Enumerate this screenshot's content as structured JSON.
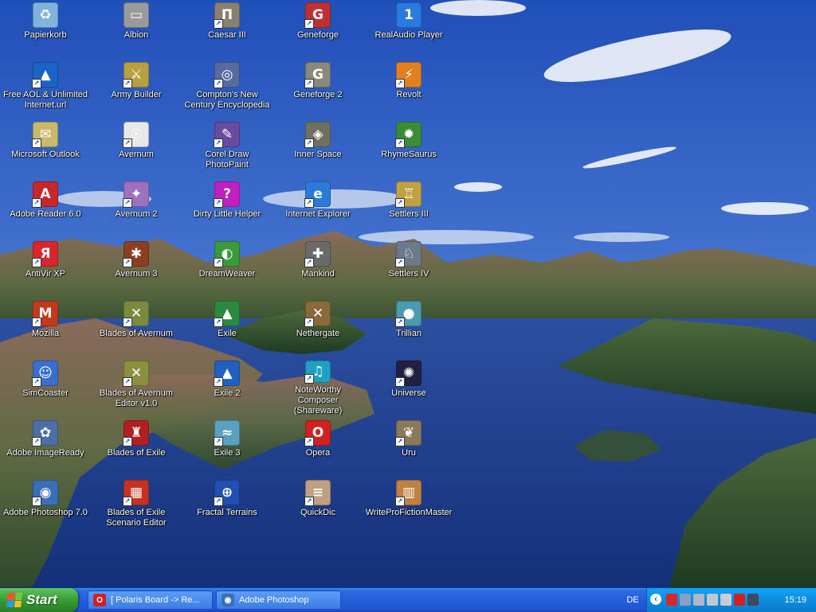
{
  "desktop": {
    "icons": [
      {
        "label": "Papierkorb",
        "icon": "recycle-bin-icon",
        "color": "#7fb3de",
        "glyph": "♻",
        "shortcut": false
      },
      {
        "label": "Free AOL & Unlimited Internet.url",
        "icon": "aol-icon",
        "color": "#1a63c7",
        "glyph": "▲",
        "shortcut": true
      },
      {
        "label": "Microsoft Outlook",
        "icon": "outlook-icon",
        "color": "#c9b96a",
        "glyph": "✉",
        "shortcut": true
      },
      {
        "label": "Adobe Reader 6.0",
        "icon": "adobe-reader-icon",
        "color": "#c8262a",
        "glyph": "A",
        "shortcut": true
      },
      {
        "label": "AntiVir XP",
        "icon": "antivir-icon",
        "color": "#d8262a",
        "glyph": "Я",
        "shortcut": true
      },
      {
        "label": "Mozilla",
        "icon": "mozilla-icon",
        "color": "#c23a1e",
        "glyph": "M",
        "shortcut": true
      },
      {
        "label": "SimCoaster",
        "icon": "simcoaster-icon",
        "color": "#3a6fd0",
        "glyph": "☺",
        "shortcut": true
      },
      {
        "label": "Adobe ImageReady",
        "icon": "imageready-icon",
        "color": "#4d6fa8",
        "glyph": "✿",
        "shortcut": true
      },
      {
        "label": "Adobe Photoshop 7.0",
        "icon": "photoshop-icon",
        "color": "#3a6fb8",
        "glyph": "◉",
        "shortcut": true
      },
      {
        "label": "Albion",
        "icon": "albion-icon",
        "color": "#9a9a9a",
        "glyph": "▭",
        "shortcut": false
      },
      {
        "label": "Army Builder",
        "icon": "army-builder-icon",
        "color": "#b8a040",
        "glyph": "⚔",
        "shortcut": true
      },
      {
        "label": "Avernum",
        "icon": "avernum-icon",
        "color": "#e8e8e8",
        "glyph": "☉",
        "shortcut": true
      },
      {
        "label": "Avernum 2",
        "icon": "avernum2-icon",
        "color": "#a070c0",
        "glyph": "✦",
        "shortcut": true
      },
      {
        "label": "Avernum 3",
        "icon": "avernum3-icon",
        "color": "#8a4020",
        "glyph": "✱",
        "shortcut": true
      },
      {
        "label": "Blades of Avernum",
        "icon": "blades-avernum-icon",
        "color": "#7a8a40",
        "glyph": "✕",
        "shortcut": true
      },
      {
        "label": "Blades of Avernum Editor v1.0",
        "icon": "blades-avernum-editor-icon",
        "color": "#8a9040",
        "glyph": "✕",
        "shortcut": true
      },
      {
        "label": "Blades of Exile",
        "icon": "blades-exile-icon",
        "color": "#b02020",
        "glyph": "♜",
        "shortcut": true
      },
      {
        "label": "Blades of Exile Scenario Editor",
        "icon": "blades-exile-editor-icon",
        "color": "#c83020",
        "glyph": "▦",
        "shortcut": true
      },
      {
        "label": "Caesar III",
        "icon": "caesar-icon",
        "color": "#8a8070",
        "glyph": "Π",
        "shortcut": true
      },
      {
        "label": "Compton's New Century Encyclopedia",
        "icon": "compton-icon",
        "color": "#5a6aa0",
        "glyph": "◎",
        "shortcut": true
      },
      {
        "label": "Corel Draw PhotoPaint",
        "icon": "photopaint-icon",
        "color": "#6a4aa0",
        "glyph": "✎",
        "shortcut": true
      },
      {
        "label": "Dirty Little Helper",
        "icon": "dirty-little-helper-icon",
        "color": "#c020c0",
        "glyph": "?",
        "shortcut": true
      },
      {
        "label": "DreamWeaver",
        "icon": "dreamweaver-icon",
        "color": "#3a9a3a",
        "glyph": "◐",
        "shortcut": true
      },
      {
        "label": "Exile",
        "icon": "exile-icon",
        "color": "#2a8a40",
        "glyph": "▲",
        "shortcut": true
      },
      {
        "label": "Exile 2",
        "icon": "exile2-icon",
        "color": "#2060c0",
        "glyph": "▲",
        "shortcut": true
      },
      {
        "label": "Exile 3",
        "icon": "exile3-icon",
        "color": "#5aa0c0",
        "glyph": "≈",
        "shortcut": true
      },
      {
        "label": "Fractal Terrains",
        "icon": "fractal-terrains-icon",
        "color": "#2050b0",
        "glyph": "⊕",
        "shortcut": true
      },
      {
        "label": "Geneforge",
        "icon": "geneforge-icon",
        "color": "#c03030",
        "glyph": "G",
        "shortcut": true
      },
      {
        "label": "Geneforge 2",
        "icon": "geneforge2-icon",
        "color": "#8a8a7a",
        "glyph": "G",
        "shortcut": true
      },
      {
        "label": "Inner Space",
        "icon": "inner-space-icon",
        "color": "#707060",
        "glyph": "◈",
        "shortcut": true
      },
      {
        "label": "Internet Explorer",
        "icon": "internet-explorer-icon",
        "color": "#2a7ad8",
        "glyph": "e",
        "shortcut": true
      },
      {
        "label": "Mankind",
        "icon": "mankind-icon",
        "color": "#6a6a6a",
        "glyph": "✚",
        "shortcut": true
      },
      {
        "label": "Nethergate",
        "icon": "nethergate-icon",
        "color": "#8a6a3a",
        "glyph": "✕",
        "shortcut": true
      },
      {
        "label": "NoteWorthy Composer (Shareware)",
        "icon": "noteworthy-icon",
        "color": "#20a0c0",
        "glyph": "♫",
        "shortcut": true
      },
      {
        "label": "Opera",
        "icon": "opera-icon",
        "color": "#d02020",
        "glyph": "O",
        "shortcut": true
      },
      {
        "label": "QuickDic",
        "icon": "quickdic-icon",
        "color": "#c0a080",
        "glyph": "≡",
        "shortcut": true
      },
      {
        "label": "RealAudio Player",
        "icon": "realaudio-icon",
        "color": "#2a7ae0",
        "glyph": "1",
        "shortcut": false
      },
      {
        "label": "Revolt",
        "icon": "revolt-icon",
        "color": "#e08020",
        "glyph": "⚡",
        "shortcut": true
      },
      {
        "label": "RhymeSaurus",
        "icon": "rhymesaurus-icon",
        "color": "#3a8a3a",
        "glyph": "✹",
        "shortcut": true
      },
      {
        "label": "Settlers III",
        "icon": "settlers3-icon",
        "color": "#c0a040",
        "glyph": "♖",
        "shortcut": true
      },
      {
        "label": "Settlers IV",
        "icon": "settlers4-icon",
        "color": "#6a7a8a",
        "glyph": "♘",
        "shortcut": true
      },
      {
        "label": "Trillian",
        "icon": "trillian-icon",
        "color": "#4a9ab0",
        "glyph": "●",
        "shortcut": true
      },
      {
        "label": "Universe",
        "icon": "universe-icon",
        "color": "#202040",
        "glyph": "✺",
        "shortcut": true
      },
      {
        "label": "Uru",
        "icon": "uru-icon",
        "color": "#8a7a5a",
        "glyph": "❦",
        "shortcut": true
      },
      {
        "label": "WriteProFictionMaster",
        "icon": "writepro-icon",
        "color": "#c08040",
        "glyph": "▥",
        "shortcut": true
      }
    ]
  },
  "taskbar": {
    "start_label": "Start",
    "tasks": [
      {
        "label": "[ Polaris Board -> Re...",
        "icon": "opera-icon",
        "color": "#d02020"
      },
      {
        "label": "Adobe Photoshop",
        "icon": "photoshop-icon",
        "color": "#3a6fb8"
      }
    ],
    "language": "DE",
    "clock": "15:19",
    "tray_icons": [
      {
        "icon": "antivir-tray-icon",
        "color": "#d8262a"
      },
      {
        "icon": "network-tray-icon",
        "color": "#8aa0c0"
      },
      {
        "icon": "monitor-tray-icon",
        "color": "#b0b8c8"
      },
      {
        "icon": "usb-tray-icon",
        "color": "#c0c8d0"
      },
      {
        "icon": "drive-tray-icon",
        "color": "#c8ccd4"
      },
      {
        "icon": "adobe-tray-icon",
        "color": "#d02020"
      },
      {
        "icon": "task-tray-icon",
        "color": "#404860"
      }
    ]
  }
}
